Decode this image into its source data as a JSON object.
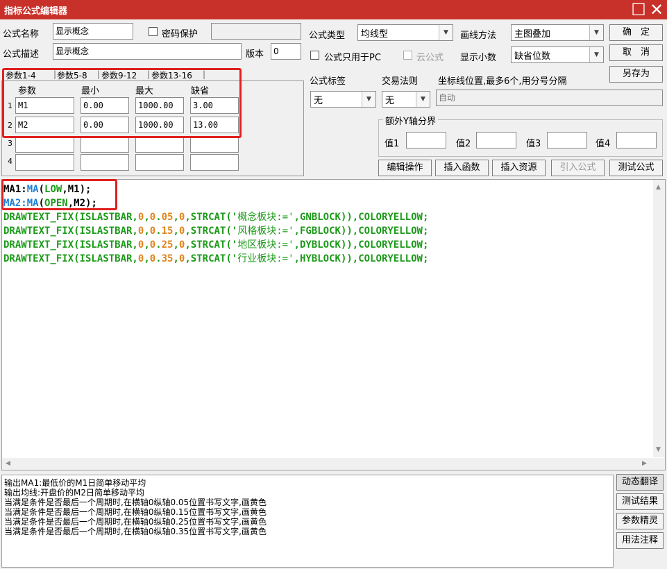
{
  "window": {
    "title": "指标公式编辑器"
  },
  "form": {
    "name_label": "公式名称",
    "name_value": "显示概念",
    "password_label": "密码保护",
    "desc_label": "公式描述",
    "desc_value": "显示概念",
    "version_label": "版本",
    "version_value": "0",
    "type_label": "公式类型",
    "type_value": "均线型",
    "draw_label": "画线方法",
    "draw_value": "主图叠加",
    "pc_only_label": "公式只用于PC",
    "cloud_label": "云公式",
    "decimal_label": "显示小数",
    "decimal_value": "缺省位数",
    "tag_label": "公式标签",
    "tag_value": "无",
    "trade_label": "交易法则",
    "trade_value": "无",
    "axis_label": "坐标线位置,最多6个,用分号分隔",
    "axis_value": "自动",
    "extra_axis_label": "额外Y轴分界",
    "v1": "值1",
    "v2": "值2",
    "v3": "值3",
    "v4": "值4"
  },
  "buttons": {
    "ok": "确　定",
    "cancel": "取　消",
    "save_as": "另存为",
    "edit": "编辑操作",
    "insert_func": "插入函数",
    "insert_res": "插入资源",
    "import": "引入公式",
    "test": "测试公式"
  },
  "tabs": [
    "参数1-4",
    "参数5-8",
    "参数9-12",
    "参数13-16"
  ],
  "params": {
    "headers": [
      "参数",
      "最小",
      "最大",
      "缺省"
    ],
    "rows": [
      {
        "num": "1",
        "name": "M1",
        "min": "0.00",
        "max": "1000.00",
        "def": "3.00"
      },
      {
        "num": "2",
        "name": "M2",
        "min": "0.00",
        "max": "1000.00",
        "def": "13.00"
      },
      {
        "num": "3",
        "name": "",
        "min": "",
        "max": "",
        "def": ""
      },
      {
        "num": "4",
        "name": "",
        "min": "",
        "max": "",
        "def": ""
      }
    ]
  },
  "code": {
    "l1": [
      "MA1:",
      "MA",
      "(",
      "LOW",
      ",M1);"
    ],
    "l2": [
      "MA2:",
      "MA",
      "(",
      "OPEN",
      ",M2);"
    ],
    "draw_prefix": "DRAWTEXT_FIX(ISLASTBAR,",
    "zero": "0",
    "comma": ",",
    "dot": ".",
    "strcat": ",STRCAT('",
    "suffix": ")),COLORYELLOW;",
    "lines": [
      {
        "frac": "05",
        "text": "概念板块:='",
        "block": ",GNBLOCK"
      },
      {
        "frac": "15",
        "text": "风格板块:='",
        "block": ",FGBLOCK"
      },
      {
        "frac": "25",
        "text": "地区板块:='",
        "block": ",DYBLOCK"
      },
      {
        "frac": "35",
        "text": "行业板块:='",
        "block": ",HYBLOCK"
      }
    ]
  },
  "output": [
    "输出MA1:最低价的M1日简单移动平均",
    "输出均线:开盘价的M2日简单移动平均",
    "当满足条件是否最后一个周期时,在横轴0纵轴0.05位置书写文字,画黄色",
    "当满足条件是否最后一个周期时,在横轴0纵轴0.15位置书写文字,画黄色",
    "当满足条件是否最后一个周期时,在横轴0纵轴0.25位置书写文字,画黄色",
    "当满足条件是否最后一个周期时,在横轴0纵轴0.35位置书写文字,画黄色"
  ],
  "side_buttons": [
    "动态翻译",
    "测试结果",
    "参数精灵",
    "用法注释"
  ],
  "colors": {
    "titlebar": "#c8312a",
    "function_green": "#1b9a18",
    "var_blue": "#1f7fd6",
    "number_orange": "#e0841b",
    "highlight_red": "#e0201f"
  }
}
